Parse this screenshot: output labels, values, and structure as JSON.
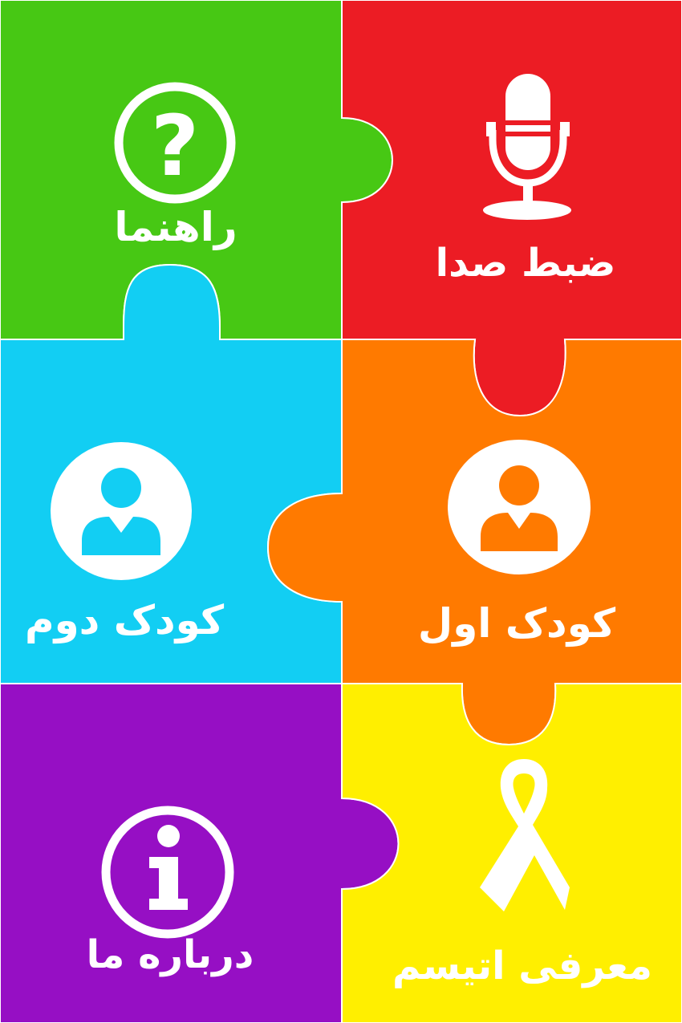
{
  "colors": {
    "help": "#47c814",
    "record": "#ec1c24",
    "child2": "#12cef3",
    "child1": "#ff7a00",
    "about": "#960fc4",
    "autism": "#ffef00",
    "separator": "#ffffff",
    "label_text": "#ffffff"
  },
  "tiles": {
    "help": {
      "label": "راهنما",
      "icon": "question-circle-icon"
    },
    "record": {
      "label": "ضبط صدا",
      "icon": "microphone-icon"
    },
    "child2": {
      "label": "کودک دوم",
      "icon": "user-avatar-icon"
    },
    "child1": {
      "label": "کودک اول",
      "icon": "user-avatar-icon"
    },
    "about": {
      "label": "درباره ما",
      "icon": "info-circle-icon"
    },
    "autism": {
      "label": "معرفی اتیسم",
      "icon": "awareness-ribbon-icon"
    }
  }
}
